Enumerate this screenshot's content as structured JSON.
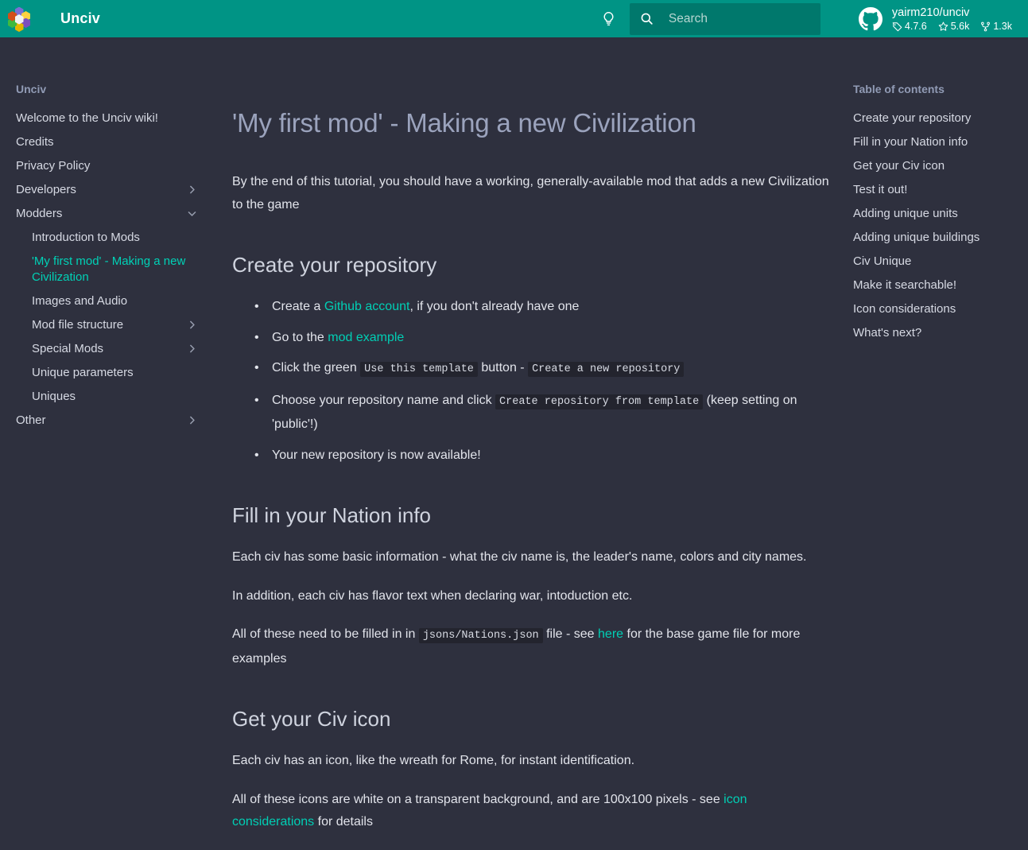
{
  "header": {
    "site_title": "Unciv",
    "logo_icon": "unciv-hex-flower-logo",
    "theme_toggle_icon": "lightbulb-icon",
    "logo_hexes": [
      {
        "name": "hex-top",
        "color": "#7b6fd4"
      },
      {
        "name": "hex-top-right",
        "color": "#ffd23f"
      },
      {
        "name": "hex-bottom-right",
        "color": "#7b4fbf"
      },
      {
        "name": "hex-bottom",
        "color": "#e5b800"
      },
      {
        "name": "hex-bottom-left",
        "color": "#3fb93f"
      },
      {
        "name": "hex-top-left",
        "color": "#d24f1a"
      },
      {
        "name": "hex-center",
        "color": "#f2f2f2"
      }
    ],
    "search": {
      "icon": "search-icon",
      "placeholder": "Search",
      "value": ""
    },
    "repo": {
      "icon": "github-icon",
      "name": "yairm210/unciv",
      "version": "4.7.6",
      "version_icon": "tag-icon",
      "stars": "5.6k",
      "stars_icon": "star-icon",
      "forks": "1.3k",
      "forks_icon": "fork-icon"
    },
    "colors": {
      "header_bg": "#009485",
      "search_bg": "#00786c",
      "accent": "#00cfb5",
      "page_bg": "#2e303e"
    }
  },
  "sidebar": {
    "title": "Unciv",
    "items": [
      {
        "label": "Welcome to the Unciv wiki!",
        "level": 0,
        "chevron": "",
        "active": false
      },
      {
        "label": "Credits",
        "level": 0,
        "chevron": "",
        "active": false
      },
      {
        "label": "Privacy Policy",
        "level": 0,
        "chevron": "",
        "active": false
      },
      {
        "label": "Developers",
        "level": 0,
        "chevron": "chevron-right-icon",
        "active": false
      },
      {
        "label": "Modders",
        "level": 0,
        "chevron": "chevron-down-icon",
        "active": false
      },
      {
        "label": "Introduction to Mods",
        "level": 1,
        "chevron": "",
        "active": false
      },
      {
        "label": "'My first mod' - Making a new Civilization",
        "level": 1,
        "chevron": "",
        "active": true
      },
      {
        "label": "Images and Audio",
        "level": 1,
        "chevron": "",
        "active": false
      },
      {
        "label": "Mod file structure",
        "level": 1,
        "chevron": "chevron-right-icon",
        "active": false
      },
      {
        "label": "Special Mods",
        "level": 1,
        "chevron": "chevron-right-icon",
        "active": false
      },
      {
        "label": "Unique parameters",
        "level": 1,
        "chevron": "",
        "active": false
      },
      {
        "label": "Uniques",
        "level": 1,
        "chevron": "",
        "active": false
      },
      {
        "label": "Other",
        "level": 0,
        "chevron": "chevron-right-icon",
        "active": false
      }
    ]
  },
  "toc": {
    "title": "Table of contents",
    "items": [
      "Create your repository",
      "Fill in your Nation info",
      "Get your Civ icon",
      "Test it out!",
      "Adding unique units",
      "Adding unique buildings",
      "Civ Unique",
      "Make it searchable!",
      "Icon considerations",
      "What's next?"
    ]
  },
  "main": {
    "title": "'My first mod' - Making a new Civilization",
    "intro": "By the end of this tutorial, you should have a working, generally-available mod that adds a new Civilization to the game",
    "section1": {
      "heading": "Create your repository",
      "bullets": {
        "b1_pre": "Create a ",
        "b1_link": "Github account",
        "b1_post": ", if you don't already have one",
        "b2_pre": "Go to the ",
        "b2_link": "mod example",
        "b3_pre": "Click the green ",
        "b3_code1": "Use this template",
        "b3_mid": " button - ",
        "b3_code2": "Create a new repository",
        "b4_pre": "Choose your repository name and click ",
        "b4_code": "Create repository from template",
        "b4_post": " (keep setting on 'public'!)",
        "b5": "Your new repository is now available!"
      }
    },
    "section2": {
      "heading": "Fill in your Nation info",
      "p1": "Each civ has some basic information - what the civ name is, the leader's name, colors and city names.",
      "p2": "In addition, each civ has flavor text when declaring war, intoduction etc.",
      "p3_pre": "All of these need to be filled in in ",
      "p3_code": "jsons/Nations.json",
      "p3_mid": " file - see ",
      "p3_link": "here",
      "p3_post": " for the base game file for more examples"
    },
    "section3": {
      "heading": "Get your Civ icon",
      "p1": "Each civ has an icon, like the wreath for Rome, for instant identification.",
      "p2_pre": "All of these icons are white on a transparent background, and are 100x100 pixels - see ",
      "p2_link": "icon considerations",
      "p2_post": " for details"
    }
  }
}
